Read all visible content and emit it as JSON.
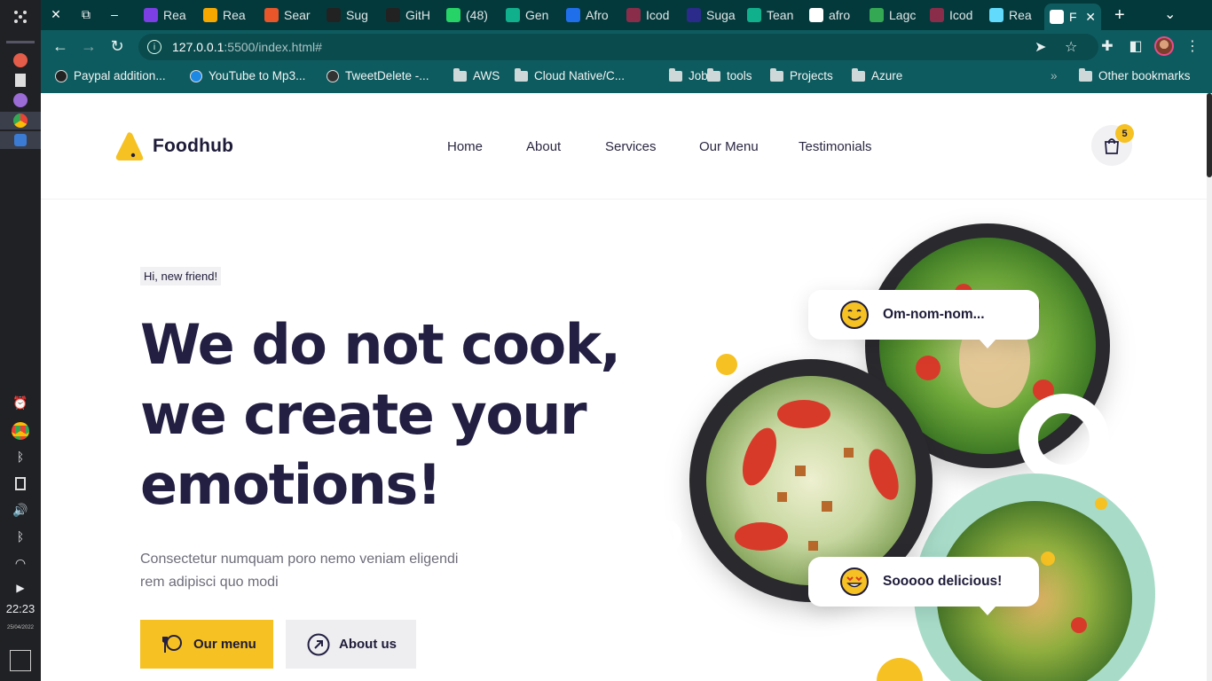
{
  "dock": {
    "clock": "22:23",
    "date": "25/04/2022"
  },
  "browser": {
    "tabs": [
      {
        "title": "Rea",
        "color": "#7b3fe4"
      },
      {
        "title": "Rea",
        "color": "#f6a800"
      },
      {
        "title": "Sear",
        "color": "#e8562a"
      },
      {
        "title": "Sug",
        "color": "#222222"
      },
      {
        "title": "GitH",
        "color": "#222222"
      },
      {
        "title": "(48)",
        "color": "#25d366"
      },
      {
        "title": "Gen",
        "color": "#10b08c"
      },
      {
        "title": "Afro",
        "color": "#1f6feb"
      },
      {
        "title": "Icod",
        "color": "#8a2d4a"
      },
      {
        "title": "Suga",
        "color": "#2b2b8c"
      },
      {
        "title": "Tean",
        "color": "#10b08c"
      },
      {
        "title": "afro",
        "color": "#ffffff"
      },
      {
        "title": "Lagc",
        "color": "#34a853"
      },
      {
        "title": "Icod",
        "color": "#8a2d4a"
      },
      {
        "title": "Rea",
        "color": "#61dafb"
      },
      {
        "title": "F",
        "color": "#ffffff"
      }
    ],
    "url_host": "127.0.0.1",
    "url_rest": ":5500/index.html#",
    "bookmarks": [
      {
        "label": "Paypal addition...",
        "kind": "site"
      },
      {
        "label": "YouTube to Mp3...",
        "kind": "site"
      },
      {
        "label": "TweetDelete -...",
        "kind": "site"
      },
      {
        "label": "AWS",
        "kind": "folder"
      },
      {
        "label": "Cloud Native/C...",
        "kind": "folder"
      },
      {
        "label": "Jobs",
        "kind": "folder"
      },
      {
        "label": "tools",
        "kind": "folder"
      },
      {
        "label": "Projects",
        "kind": "folder"
      },
      {
        "label": "Azure",
        "kind": "folder"
      }
    ],
    "overflow": "»",
    "other_bookmarks": "Other bookmarks"
  },
  "site": {
    "brand": "Foodhub",
    "nav": [
      "Home",
      "About",
      "Services",
      "Our Menu",
      "Testimonials"
    ],
    "cart_count": "5",
    "greeting": "Hi, new friend!",
    "headline": "We do not cook, we create your emotions!",
    "lead": "Consectetur numquam poro nemo veniam eligendi rem adipisci quo modi",
    "btn_menu": "Our menu",
    "btn_about": "About us",
    "bubble_top": "Om-nom-nom...",
    "bubble_bottom": "Sooooo delicious!",
    "accent": "#f6c122",
    "ink": "#221f42"
  }
}
